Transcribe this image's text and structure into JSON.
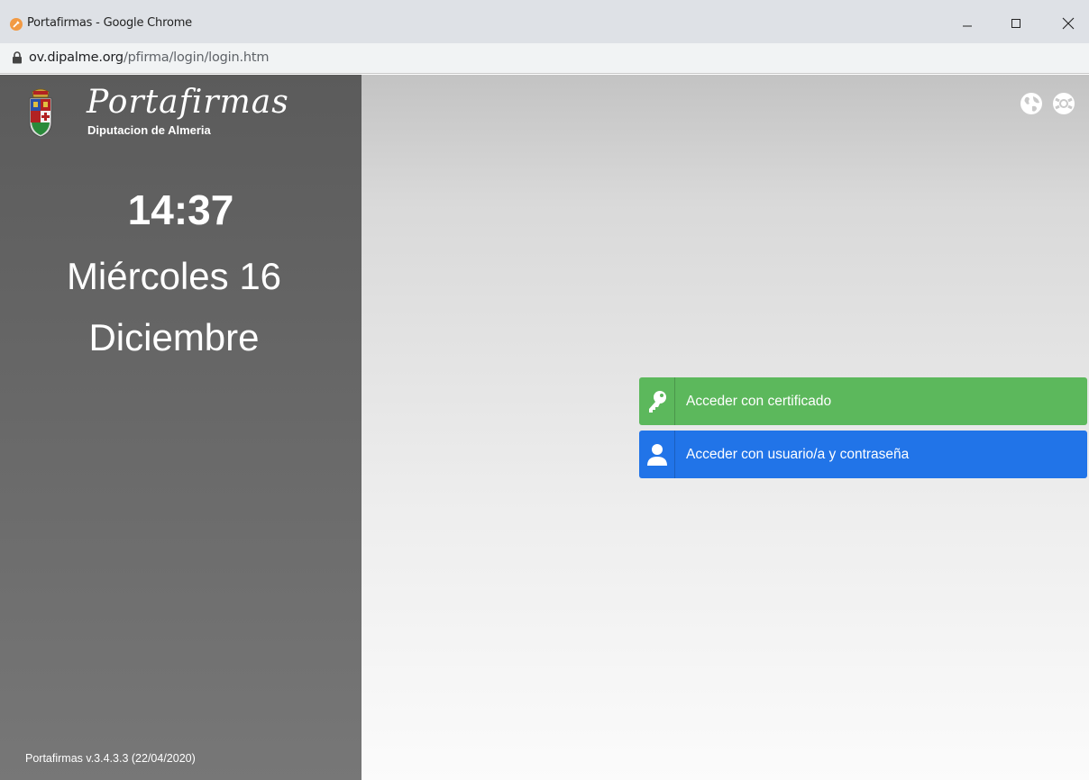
{
  "window": {
    "title": "Portafirmas - Google Chrome",
    "url_domain": "ov.dipalme.org",
    "url_path": "/pfirma/login/login.htm"
  },
  "sidebar": {
    "brand": "Portafirmas",
    "subtitle": "Diputacion de Almeria",
    "time": "14:37",
    "day": "Miércoles 16",
    "month": "Diciembre",
    "version": "Portafirmas v.3.4.3.3 (22/04/2020)"
  },
  "main": {
    "icons": [
      "globe-icon",
      "help-lifebuoy-icon"
    ],
    "buttons": {
      "certificate": "Acceder con certificado",
      "user": "Acceder con usuario/a y contraseña"
    }
  },
  "colors": {
    "certificate_button": "#5cb85c",
    "user_button": "#2174e8",
    "sidebar": "#666666"
  }
}
